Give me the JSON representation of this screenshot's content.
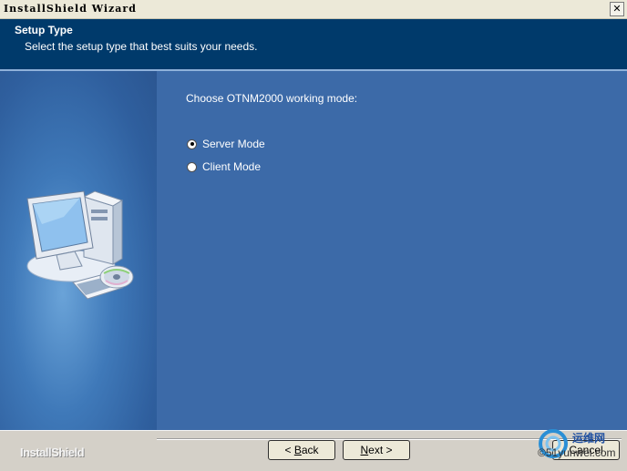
{
  "window": {
    "title": "InstallShield Wizard",
    "close_glyph": "✕"
  },
  "header": {
    "title": "Setup Type",
    "subtitle": "Select the setup type that best suits your needs."
  },
  "main": {
    "prompt": "Choose OTNM2000 working mode:",
    "options": [
      {
        "label": "Server Mode",
        "selected": true
      },
      {
        "label": "Client Mode",
        "selected": false
      }
    ]
  },
  "footer": {
    "brand": "InstallShield",
    "back_prefix": "< ",
    "back_mnemonic": "B",
    "back_rest": "ack",
    "next_mnemonic": "N",
    "next_rest": "ext >",
    "cancel_label": "Cancel"
  },
  "watermark": {
    "cn_text": "运维网",
    "en_text": "©51yunwei.com"
  },
  "icons": [
    "computer-cd-illustration",
    "close-icon",
    "radio-selected-icon",
    "radio-unselected-icon"
  ],
  "colors": {
    "banner": "#003a6b",
    "panel": "#3c6aa8",
    "footer": "#d4d0c8"
  }
}
